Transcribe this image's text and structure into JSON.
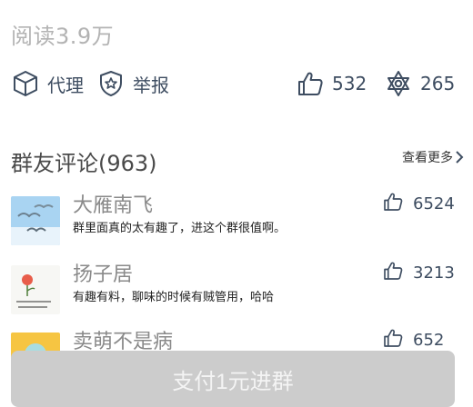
{
  "stats": {
    "read_count": "阅读3.9万"
  },
  "actions": {
    "agent_label": "代理",
    "report_label": "举报",
    "like_count": "532",
    "share_count": "265"
  },
  "comments_section": {
    "title": "群友评论(963)",
    "see_more": "查看更多",
    "items": [
      {
        "name": "大雁南飞",
        "text": "群里面真的太有趣了，进这个群很值啊。",
        "likes": "6524",
        "avatar": "sky-birds-photo"
      },
      {
        "name": "扬子居",
        "text": "有趣有料，聊味的时候有贼管用，哈哈",
        "likes": "3213",
        "avatar": "flower-sketch"
      },
      {
        "name": "卖萌不是病",
        "text": "",
        "likes": "652",
        "avatar": "cartoon-yellow"
      }
    ]
  },
  "footer": {
    "pay_button": "支付1元进群"
  },
  "colors": {
    "icon": "#3e4d61",
    "muted": "#b3b3b3",
    "button_bg": "#cccccc"
  }
}
